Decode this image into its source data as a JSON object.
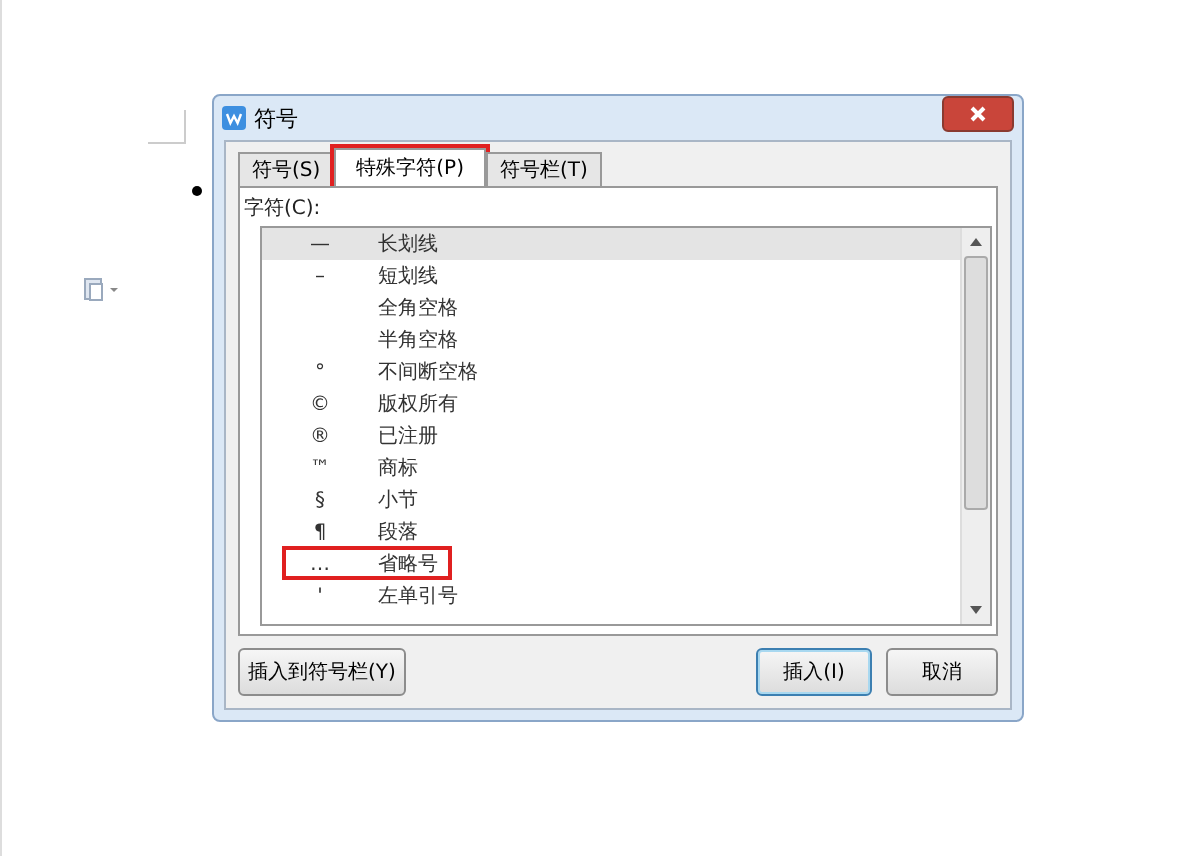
{
  "window": {
    "title": "符号"
  },
  "tabs": [
    {
      "label": "符号(S)",
      "selected": false,
      "highlighted": false
    },
    {
      "label": "特殊字符(P)",
      "selected": true,
      "highlighted": true
    },
    {
      "label": "符号栏(T)",
      "selected": false,
      "highlighted": false
    }
  ],
  "list_label": "字符(C):",
  "items": [
    {
      "symbol": "—",
      "name": "长划线",
      "selected": true,
      "highlighted": false
    },
    {
      "symbol": "–",
      "name": "短划线",
      "selected": false,
      "highlighted": false
    },
    {
      "name": "全角空格",
      "selected": false,
      "highlighted": false
    },
    {
      "name": "半角空格",
      "selected": false,
      "highlighted": false
    },
    {
      "symbol": "°",
      "name": "不间断空格",
      "selected": false,
      "highlighted": false
    },
    {
      "symbol": "©",
      "name": "版权所有",
      "selected": false,
      "highlighted": false
    },
    {
      "symbol": "®",
      "name": "已注册",
      "selected": false,
      "highlighted": false
    },
    {
      "symbol": "™",
      "name": "商标",
      "selected": false,
      "highlighted": false
    },
    {
      "symbol": "§",
      "name": "小节",
      "selected": false,
      "highlighted": false
    },
    {
      "symbol": "¶",
      "name": "段落",
      "selected": false,
      "highlighted": false
    },
    {
      "symbol": "…",
      "name": "省略号",
      "selected": false,
      "highlighted": true
    },
    {
      "symbol": "'",
      "name": "左单引号",
      "selected": false,
      "highlighted": false
    }
  ],
  "buttons": [
    {
      "label": "插入到符号栏(Y)",
      "kind": "secondary"
    },
    {
      "label": "插入(I)",
      "kind": "default"
    },
    {
      "label": "取消",
      "kind": "secondary"
    }
  ]
}
